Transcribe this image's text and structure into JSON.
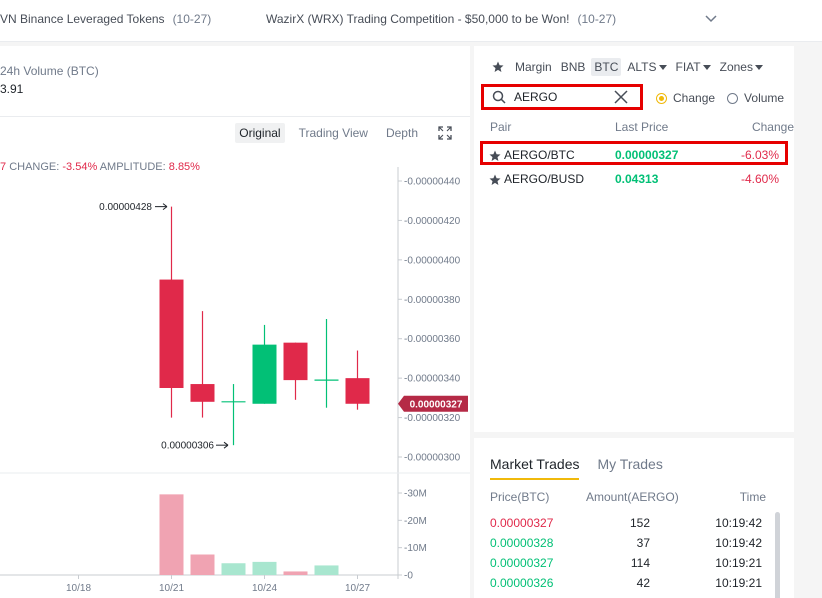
{
  "announcements": [
    {
      "text": "VN Binance Leveraged Tokens",
      "date": "(10-27)"
    },
    {
      "text": "WazirX (WRX) Trading Competition - $50,000 to be Won!",
      "date": "(10-27)"
    }
  ],
  "ticker": {
    "volume_label": "24h Volume (BTC)",
    "volume_value": "3.91"
  },
  "chart_tabs": [
    {
      "label": "Original",
      "active": true
    },
    {
      "label": "Trading View",
      "active": false
    },
    {
      "label": "Depth",
      "active": false
    }
  ],
  "stats": {
    "prefix": "7",
    "change_label": "CHANGE:",
    "change_value": "-3.54%",
    "amplitude_label": "AMPLITUDE:",
    "amplitude_value": "8.85%"
  },
  "colors": {
    "up": "#02c076",
    "down": "#e0294a",
    "accent": "#f0b90b",
    "highlight": "#e60000"
  },
  "chart_data": {
    "type": "candlestick",
    "x": [
      "10/21",
      "10/22",
      "10/23",
      "10/24",
      "10/25",
      "10/26",
      "10/27"
    ],
    "candles": [
      {
        "open": 3.9e-06,
        "high": 4.27e-06,
        "low": 3.2e-06,
        "close": 3.35e-06,
        "direction": "down"
      },
      {
        "open": 3.37e-06,
        "high": 3.74e-06,
        "low": 3.2e-06,
        "close": 3.28e-06,
        "direction": "down"
      },
      {
        "open": 3.28e-06,
        "high": 3.37e-06,
        "low": 3.06e-06,
        "close": 3.28e-06,
        "direction": "doji"
      },
      {
        "open": 3.27e-06,
        "high": 3.67e-06,
        "low": 3.27e-06,
        "close": 3.57e-06,
        "direction": "up"
      },
      {
        "open": 3.58e-06,
        "high": 3.58e-06,
        "low": 3.29e-06,
        "close": 3.39e-06,
        "direction": "down"
      },
      {
        "open": 3.39e-06,
        "high": 3.7e-06,
        "low": 3.25e-06,
        "close": 3.39e-06,
        "direction": "doji"
      },
      {
        "open": 3.4e-06,
        "high": 3.54e-06,
        "low": 3.24e-06,
        "close": 3.27e-06,
        "direction": "down"
      }
    ],
    "volume": [
      29500000,
      7500000,
      4300000,
      4800000,
      1300000,
      3500000,
      0
    ],
    "y_ticks": [
      "0.00000440",
      "0.00000420",
      "0.00000400",
      "0.00000380",
      "0.00000360",
      "0.00000340",
      "0.00000320",
      "0.00000300"
    ],
    "ylim": [
      3e-06,
      4.4e-06
    ],
    "vol_ticks": [
      "30M",
      "20M",
      "10M",
      "0"
    ],
    "vol_ylim": [
      0,
      30000000
    ],
    "x_ticks": [
      "10/18",
      "10/21",
      "10/24",
      "10/27"
    ],
    "high_label": "0.00000428",
    "low_label": "0.00000306",
    "current_price": "0.00000327"
  },
  "market": {
    "tabs": [
      {
        "label": "Margin",
        "active": false,
        "caret": false
      },
      {
        "label": "BNB",
        "active": false,
        "caret": false
      },
      {
        "label": "BTC",
        "active": true,
        "caret": false
      },
      {
        "label": "ALTS",
        "active": false,
        "caret": true
      },
      {
        "label": "FIAT",
        "active": false,
        "caret": true
      },
      {
        "label": "Zones",
        "active": false,
        "caret": true
      }
    ],
    "search_value": "AERGO",
    "radio_change": "Change",
    "radio_volume": "Volume",
    "headers": {
      "pair": "Pair",
      "last_price": "Last Price",
      "change": "Change"
    },
    "pairs": [
      {
        "pair": "AERGO/BTC",
        "price": "0.00000327",
        "change": "-6.03%",
        "highlighted": true
      },
      {
        "pair": "AERGO/BUSD",
        "price": "0.04313",
        "change": "-4.60%",
        "highlighted": false
      }
    ]
  },
  "trades": {
    "tab_market": "Market Trades",
    "tab_my": "My Trades",
    "headers": {
      "price": "Price(BTC)",
      "amount": "Amount(AERGO)",
      "time": "Time"
    },
    "rows": [
      {
        "price": "0.00000327",
        "amount": "152",
        "time": "10:19:42",
        "side": "down"
      },
      {
        "price": "0.00000328",
        "amount": "37",
        "time": "10:19:42",
        "side": "up"
      },
      {
        "price": "0.00000327",
        "amount": "114",
        "time": "10:19:21",
        "side": "up"
      },
      {
        "price": "0.00000326",
        "amount": "42",
        "time": "10:19:21",
        "side": "up"
      }
    ]
  }
}
